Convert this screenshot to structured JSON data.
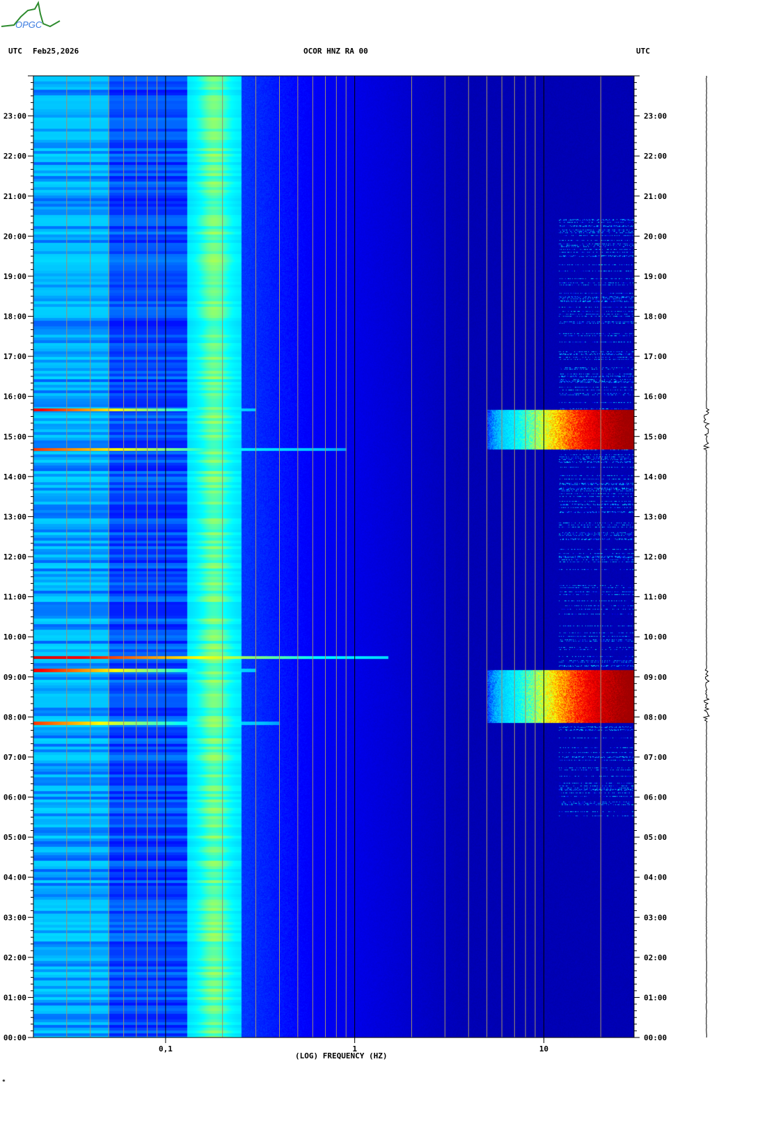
{
  "header": {
    "left_tz": "UTC",
    "date": "Feb25,2026",
    "station": "OCOR HNZ RA 00",
    "right_tz": "UTC"
  },
  "logo": {
    "text": "OPGC"
  },
  "footer_mark": "*",
  "chart_data": {
    "type": "heatmap",
    "title": "OCOR HNZ RA 00",
    "xlabel": "(LOG) FREQUENCY (HZ)",
    "ylabel": "UTC",
    "xscale": "log",
    "xlim": [
      0.02,
      30
    ],
    "ylim_hours": [
      0,
      24
    ],
    "x_ticks": [
      {
        "value": 0.1,
        "label": "0,1"
      },
      {
        "value": 1,
        "label": "1"
      },
      {
        "value": 10,
        "label": "10"
      }
    ],
    "y_ticks": [
      "00:00",
      "01:00",
      "02:00",
      "03:00",
      "04:00",
      "05:00",
      "06:00",
      "07:00",
      "08:00",
      "09:00",
      "10:00",
      "11:00",
      "12:00",
      "13:00",
      "14:00",
      "15:00",
      "16:00",
      "17:00",
      "18:00",
      "19:00",
      "20:00",
      "21:00",
      "22:00",
      "23:00"
    ],
    "colormap": [
      "#0000a0",
      "#0000ff",
      "#00c0ff",
      "#00ffff",
      "#ffff00",
      "#ff0000",
      "#a00000"
    ],
    "features": [
      {
        "name": "microseism peak",
        "freq_range_hz": [
          0.14,
          0.22
        ],
        "time_range_h": [
          0,
          24
        ],
        "level": 0.55
      },
      {
        "name": "high-frequency burst",
        "freq_range_hz": [
          5,
          30
        ],
        "time_range_h": [
          14.68,
          15.67
        ],
        "level": 0.95
      },
      {
        "name": "high-frequency burst",
        "freq_range_hz": [
          5,
          30
        ],
        "time_range_h": [
          7.85,
          9.17
        ],
        "level": 0.95
      },
      {
        "name": "broadband line",
        "freq_range_hz": [
          0.02,
          1.5
        ],
        "time_h": 9.49,
        "level": 0.9
      },
      {
        "name": "line",
        "freq_range_hz": [
          0.02,
          0.3
        ],
        "time_h": 15.67,
        "level": 0.85
      },
      {
        "name": "line",
        "freq_range_hz": [
          0.02,
          0.9
        ],
        "time_h": 14.68,
        "level": 0.8
      },
      {
        "name": "line",
        "freq_range_hz": [
          0.02,
          0.3
        ],
        "time_h": 9.17,
        "level": 0.85
      },
      {
        "name": "line",
        "freq_range_hz": [
          0.02,
          0.4
        ],
        "time_h": 7.85,
        "level": 0.8
      },
      {
        "name": "daytime cultural noise",
        "freq_range_hz": [
          12,
          30
        ],
        "time_range_h": [
          5.5,
          20.5
        ],
        "level": 0.4
      }
    ]
  }
}
